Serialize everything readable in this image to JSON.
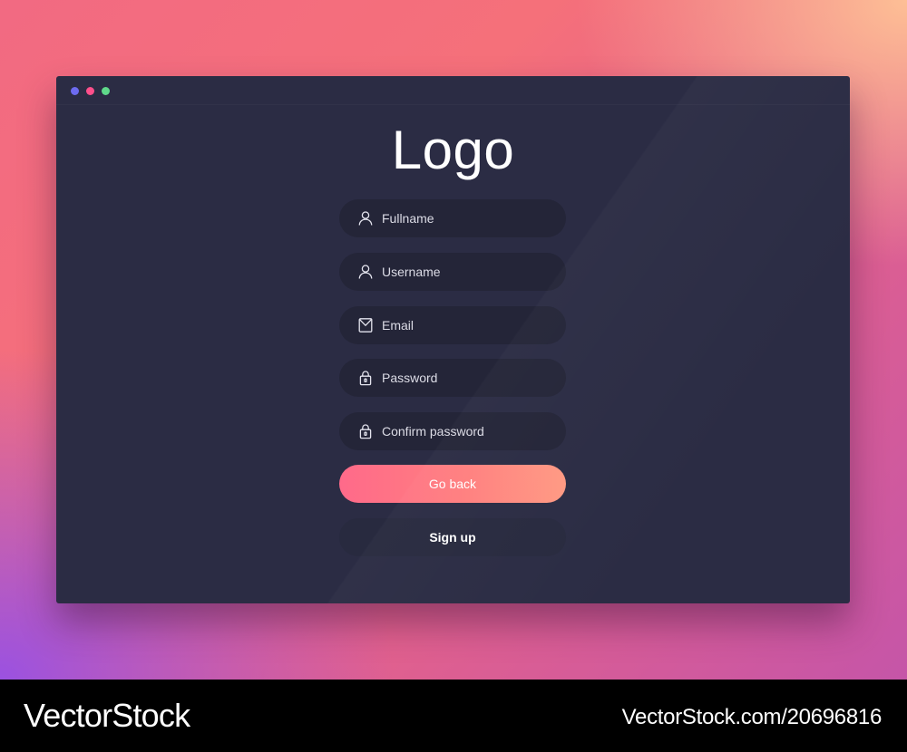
{
  "colors": {
    "window_bg": "#2b2c44",
    "field_bg": "#242538",
    "accent_start": "#ff6a8a",
    "accent_end": "#ff9a83",
    "dot_1": "#6d6bf0",
    "dot_2": "#ff4f8b",
    "dot_3": "#5fd98a"
  },
  "window": {
    "title_dots": [
      "dot-purple",
      "dot-pink",
      "dot-green"
    ]
  },
  "form": {
    "logo": "Logo",
    "fields": [
      {
        "icon": "user-icon",
        "placeholder": "Fullname",
        "value": ""
      },
      {
        "icon": "user-icon",
        "placeholder": "Username",
        "value": ""
      },
      {
        "icon": "envelope-icon",
        "placeholder": "Email",
        "value": ""
      },
      {
        "icon": "lock-icon",
        "placeholder": "Password",
        "value": ""
      },
      {
        "icon": "lock-icon",
        "placeholder": "Confirm password",
        "value": ""
      }
    ],
    "go_back_label": "Go back",
    "sign_up_label": "Sign up"
  },
  "footer": {
    "brand": "VectorStock",
    "reference": "VectorStock.com/20696816"
  }
}
